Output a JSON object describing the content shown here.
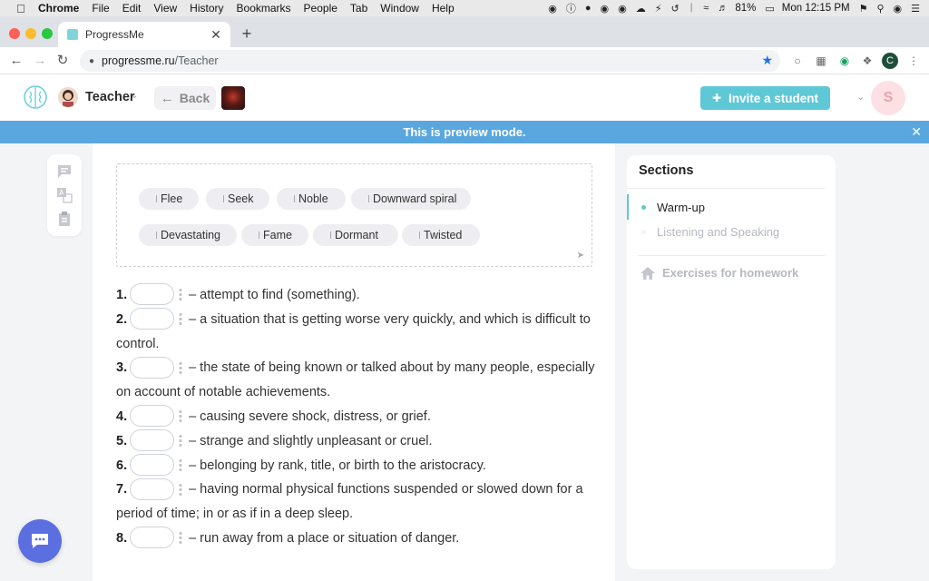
{
  "menubar": {
    "app": "Chrome",
    "items": [
      "File",
      "Edit",
      "View",
      "History",
      "Bookmarks",
      "People",
      "Tab",
      "Window",
      "Help"
    ],
    "battery": "81%",
    "clock": "Mon 12:15 PM"
  },
  "browser": {
    "tab_title": "ProgressMe",
    "url_host": "progressme.ru",
    "url_path": "/Teacher",
    "profile_initial": "C"
  },
  "header": {
    "role": "Teacher",
    "back_label": "Back",
    "invite_label": "Invite a student",
    "user_initial": "S"
  },
  "banner": {
    "text": "This is preview mode."
  },
  "word_bank": [
    "Flee",
    "Seek",
    "Noble",
    "Downward spiral",
    "Devastating",
    "Fame",
    "Dormant",
    "Twisted"
  ],
  "exercise": [
    {
      "num": "1.",
      "text": "– attempt to find (something)."
    },
    {
      "num": "2.",
      "text": "– a situation that is getting worse very quickly, and which is difficult to control."
    },
    {
      "num": "3.",
      "text": "– the state of being known or talked about by many people, especially on account of notable achievements."
    },
    {
      "num": "4.",
      "text": "– causing severe shock, distress, or grief."
    },
    {
      "num": "5.",
      "text": "– strange and slightly unpleasant or cruel."
    },
    {
      "num": "6.",
      "text": "– belonging by rank, title, or birth to the aristocracy."
    },
    {
      "num": "7.",
      "text": "– having normal physical functions suspended or slowed down for a period of time; in or as if in a deep sleep."
    },
    {
      "num": "8.",
      "text": "– run away from a place or situation of danger."
    }
  ],
  "sections": {
    "title": "Sections",
    "items": [
      {
        "label": "Warm-up",
        "active": true
      },
      {
        "label": "Listening and Speaking",
        "active": false
      }
    ],
    "homework_label": "Exercises for homework"
  },
  "colors": {
    "accent": "#5ec8d6",
    "banner": "#5aa7e0",
    "chat": "#5b6fe0"
  }
}
